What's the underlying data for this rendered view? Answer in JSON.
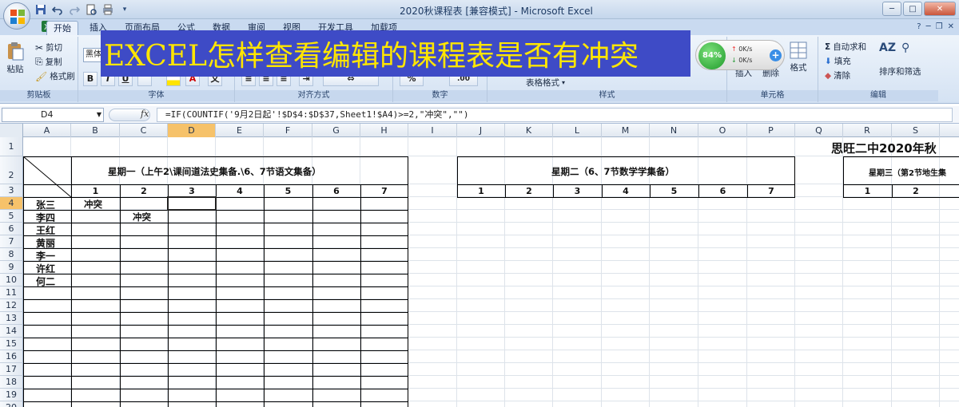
{
  "window": {
    "title": "2020秋课程表  [兼容模式] - Microsoft Excel",
    "controls": [
      "─",
      "□",
      "✕"
    ]
  },
  "tabs": [
    {
      "label": "开始",
      "active": true
    },
    {
      "label": "插入"
    },
    {
      "label": "页面布局"
    },
    {
      "label": "公式"
    },
    {
      "label": "数据"
    },
    {
      "label": "审阅"
    },
    {
      "label": "视图"
    },
    {
      "label": "开发工具"
    },
    {
      "label": "加载项"
    }
  ],
  "ribbon": {
    "clipboard": {
      "paste": "粘贴",
      "cut": "剪切",
      "copy": "复制",
      "format_painter": "格式刷",
      "label": "剪贴板"
    },
    "font": {
      "name": "黑体",
      "bold": "B",
      "italic": "I",
      "underline": "U",
      "label": "字体"
    },
    "alignment": {
      "label": "对齐方式"
    },
    "number": {
      "label": "数字"
    },
    "styles": {
      "table_format": "表格格式",
      "label": "样式"
    },
    "cells": {
      "insert": "插入",
      "delete": "删除",
      "format": "格式",
      "label": "单元格"
    },
    "editing": {
      "autosum": "自动求和",
      "fill": "填充",
      "clear": "清除",
      "sort_filter": "排序和筛选",
      "find_select": "查找和选择",
      "label": "编辑"
    }
  },
  "banner": {
    "text": "EXCEL怎样查看编辑的课程表是否有冲突"
  },
  "net_widget": {
    "percent": "84%",
    "up": "0K/s",
    "down": "0K/s"
  },
  "formula_bar": {
    "name_box": "D4",
    "fx": "fx",
    "formula": "=IF(COUNTIF('9月2日起'!$D$4:$D$37,Sheet1!$A4)>=2,\"冲突\",\"\")"
  },
  "sheet": {
    "columns": [
      "A",
      "B",
      "C",
      "D",
      "E",
      "F",
      "G",
      "H",
      "I",
      "J",
      "K",
      "L",
      "M",
      "N",
      "O",
      "P",
      "Q",
      "R",
      "S"
    ],
    "rows": [
      "1",
      "2",
      "3",
      "4",
      "5",
      "6",
      "7",
      "8",
      "9",
      "10",
      "11",
      "12",
      "13",
      "14",
      "15",
      "16",
      "17",
      "18",
      "19",
      "20"
    ],
    "selected_cell": "D4",
    "school_title": "思旺二中2020年秋",
    "day_headers": [
      "星期一（上午2\\课间道法史集备.\\6、7节语文集备）",
      "星期二（6、7节数学学集备）",
      "星期三（第2节地生集"
    ],
    "periods": [
      "1",
      "2",
      "3",
      "4",
      "5",
      "6",
      "7"
    ],
    "teachers": [
      "张三",
      "李四",
      "王红",
      "黄丽",
      "李一",
      "许红",
      "何二"
    ],
    "conflicts": [
      "冲突",
      "冲突"
    ]
  },
  "colors": {
    "selected_header": "#f6c26a",
    "banner_bg": "#3e4bc6",
    "banner_text": "#ffe600"
  }
}
